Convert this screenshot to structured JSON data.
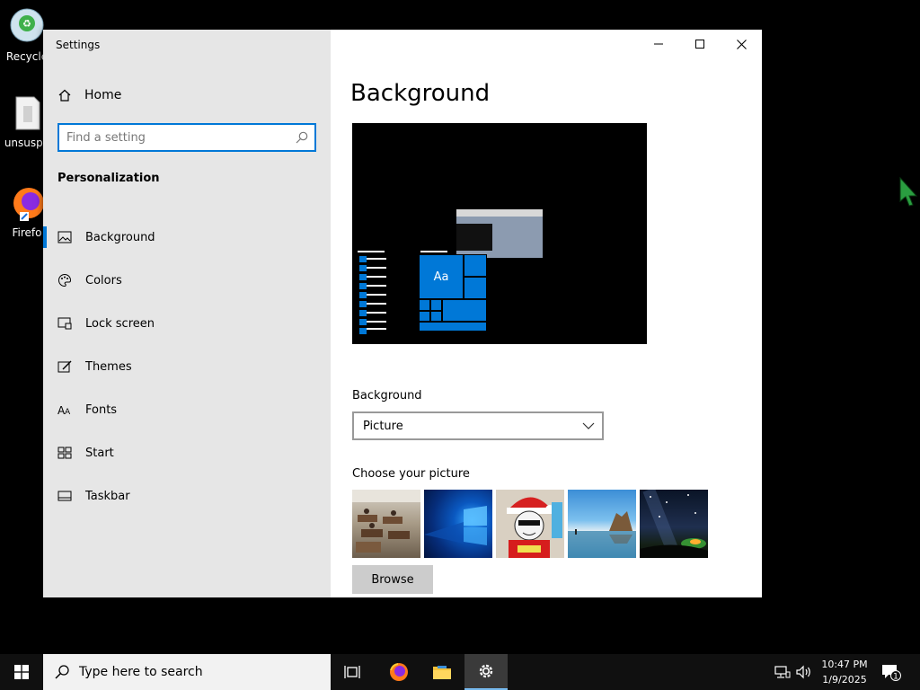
{
  "desktop": {
    "icons": [
      {
        "label": "Recycle"
      },
      {
        "label": "unsuspe"
      },
      {
        "label": "Firefo"
      }
    ]
  },
  "window": {
    "title": "Settings",
    "controls": [
      "minimize-icon",
      "maximize-icon",
      "close-icon"
    ]
  },
  "sidebar": {
    "home_label": "Home",
    "search_placeholder": "Find a setting",
    "section_title": "Personalization",
    "items": [
      {
        "label": "Background",
        "icon": "picture-icon",
        "active": true
      },
      {
        "label": "Colors",
        "icon": "palette-icon"
      },
      {
        "label": "Lock screen",
        "icon": "lock-screen-icon"
      },
      {
        "label": "Themes",
        "icon": "themes-icon"
      },
      {
        "label": "Fonts",
        "icon": "fonts-icon"
      },
      {
        "label": "Start",
        "icon": "start-icon"
      },
      {
        "label": "Taskbar",
        "icon": "taskbar-icon"
      }
    ]
  },
  "content": {
    "title": "Background",
    "preview_tile_text": "Aa",
    "background_label": "Background",
    "background_value": "Picture",
    "choose_label": "Choose your picture",
    "browse_label": "Browse"
  },
  "taskbar": {
    "search_placeholder": "Type here to search",
    "time": "10:47 PM",
    "date": "1/9/2025",
    "notification_count": "1"
  },
  "colors": {
    "accent": "#0078d7",
    "sidebar": "#e6e6e6",
    "taskbar": "#101010"
  }
}
